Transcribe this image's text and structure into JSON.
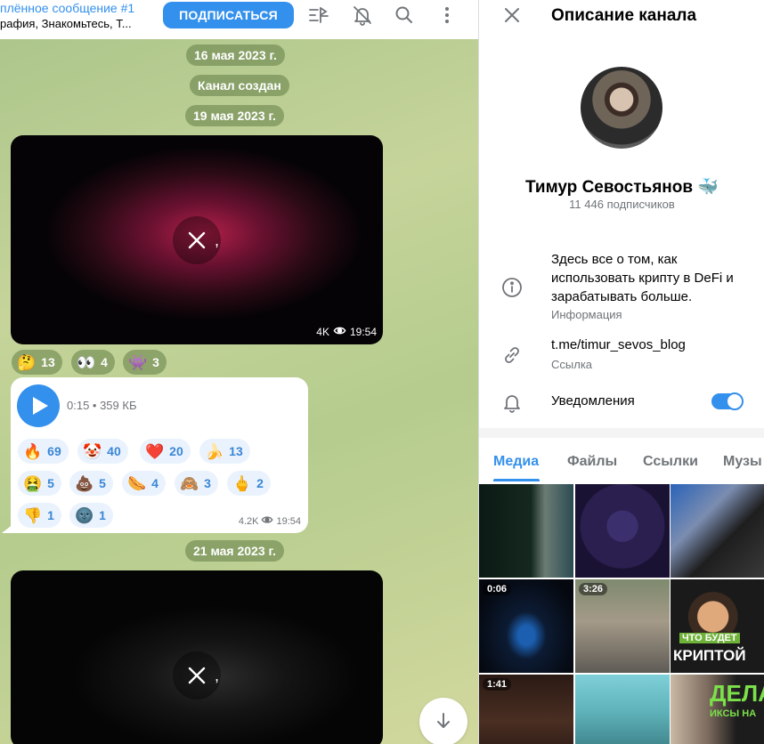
{
  "header": {
    "pinned_title": "плённое сообщение #1",
    "pinned_text": "рафия, Знакомьтесь, Т...",
    "subscribe_label": "ПОДПИСАТЬСЯ"
  },
  "chat": {
    "dates": [
      "16 мая 2023 г.",
      "19 мая 2023 г.",
      "21 мая 2023 г."
    ],
    "service_message": "Канал создан",
    "video1": {
      "quality": "4K",
      "time": "19:54",
      "comma": ","
    },
    "video1_reactions": [
      {
        "emoji": "🤔",
        "count": "13"
      },
      {
        "emoji": "👀",
        "count": "4"
      },
      {
        "emoji": "👾",
        "count": "3"
      }
    ],
    "voice": {
      "meta": "0:15 • 359 КБ",
      "views": "4.2K",
      "time": "19:54",
      "reactions": [
        {
          "emoji": "🔥",
          "count": "69"
        },
        {
          "emoji": "🤡",
          "count": "40"
        },
        {
          "emoji": "❤️",
          "count": "20"
        },
        {
          "emoji": "🍌",
          "count": "13"
        },
        {
          "emoji": "🤮",
          "count": "5"
        },
        {
          "emoji": "💩",
          "count": "5"
        },
        {
          "emoji": "🌭",
          "count": "4"
        },
        {
          "emoji": "🙈",
          "count": "3"
        },
        {
          "emoji": "🖕",
          "count": "2"
        },
        {
          "emoji": "👎",
          "count": "1"
        },
        {
          "emoji": "🌚",
          "count": "1"
        }
      ]
    },
    "video2": {
      "comma": ","
    }
  },
  "info": {
    "title": "Описание канала",
    "channel_name": "Тимур Севостьянов 🐳",
    "subscribers": "11 446 подписчиков",
    "description": "Здесь все о том, как использовать крипту в DeFi и зарабатывать больше.",
    "description_caption": "Информация",
    "link": "t.me/timur_sevos_blog",
    "link_caption": "Ссылка",
    "notifications_label": "Уведомления",
    "notifications_on": true,
    "tabs": [
      "Медиа",
      "Файлы",
      "Ссылки",
      "Музы"
    ],
    "media": [
      {
        "duration": "",
        "caption": ""
      },
      {
        "duration": "",
        "caption": ""
      },
      {
        "duration": "",
        "caption": ""
      },
      {
        "duration": "0:06",
        "caption": ""
      },
      {
        "duration": "3:26",
        "caption": ""
      },
      {
        "duration": "",
        "caption": "ЧТО БУДЕТ",
        "caption2": "КРИПТОЙ"
      },
      {
        "duration": "1:41",
        "caption": ""
      },
      {
        "duration": "",
        "caption": ""
      },
      {
        "duration": "",
        "caption": "ДЕЛА",
        "caption2": "ИКСЫ НА"
      }
    ]
  },
  "colors": {
    "accent": "#3390ec",
    "bubble_reaction_bg": "#eaf3fd",
    "secondary_text": "#707579"
  },
  "icons": [
    "tune-icon",
    "bell-off-icon",
    "search-icon",
    "more-vertical-icon",
    "close-icon",
    "info-icon",
    "link-icon",
    "bell-icon",
    "play-icon",
    "eye-icon",
    "arrow-down-icon"
  ]
}
